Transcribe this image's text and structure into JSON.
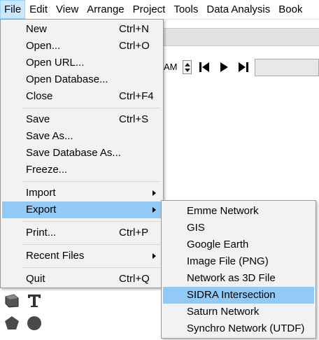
{
  "menubar": {
    "items": [
      "File",
      "Edit",
      "View",
      "Arrange",
      "Project",
      "Tools",
      "Data Analysis",
      "Book"
    ]
  },
  "toolbar": {
    "time_value": "AM"
  },
  "file_menu": {
    "items": [
      {
        "label": "New",
        "shortcut": "Ctrl+N"
      },
      {
        "label": "Open...",
        "shortcut": "Ctrl+O"
      },
      {
        "label": "Open URL...",
        "shortcut": ""
      },
      {
        "label": "Open Database...",
        "shortcut": ""
      },
      {
        "label": "Close",
        "shortcut": "Ctrl+F4"
      },
      {
        "label": "Save",
        "shortcut": "Ctrl+S"
      },
      {
        "label": "Save As...",
        "shortcut": ""
      },
      {
        "label": "Save Database As...",
        "shortcut": ""
      },
      {
        "label": "Freeze...",
        "shortcut": ""
      },
      {
        "label": "Import",
        "shortcut": ""
      },
      {
        "label": "Export",
        "shortcut": ""
      },
      {
        "label": "Print...",
        "shortcut": "Ctrl+P"
      },
      {
        "label": "Recent Files",
        "shortcut": ""
      },
      {
        "label": "Quit",
        "shortcut": "Ctrl+Q"
      }
    ]
  },
  "export_submenu": {
    "items": [
      "Emme Network",
      "GIS",
      "Google Earth",
      "Image File (PNG)",
      "Network as 3D File",
      "SIDRA Intersection",
      "Saturn Network",
      "Synchro Network (UTDF)"
    ]
  },
  "colors": {
    "highlight": "#91c9f7",
    "menu_background": "#f2f2f2",
    "active_menubar": "#cce8ff"
  },
  "icons": [
    "spin-up-icon",
    "spin-down-icon",
    "skip-back-icon",
    "play-icon",
    "skip-forward-icon",
    "submenu-arrow-icon",
    "text-tool-icon",
    "shape-tool-icon",
    "pentagon-tool-icon",
    "circle-tool-icon"
  ]
}
